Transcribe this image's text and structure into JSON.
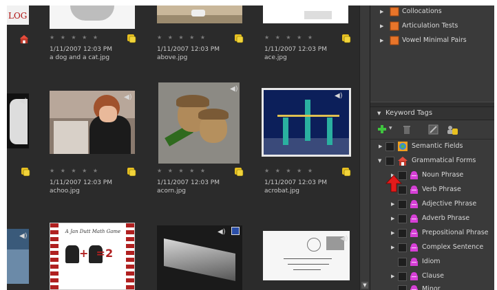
{
  "grid": {
    "row1": [
      {
        "date": "1/11/2007 12:03 PM",
        "name": "a dog and a cat.jpg",
        "stars": "★ ★ ★ ★ ★"
      },
      {
        "date": "1/11/2007 12:03 PM",
        "name": "above.jpg",
        "stars": "★ ★ ★ ★ ★"
      },
      {
        "date": "1/11/2007 12:03 PM",
        "name": "ace.jpg",
        "stars": "★ ★ ★ ★ ★"
      }
    ],
    "row2": [
      {
        "date": "1/11/2007 12:03 PM",
        "name": "achoo.jpg",
        "stars": "★ ★ ★ ★ ★"
      },
      {
        "date": "1/11/2007 12:03 PM",
        "name": "acorn.jpg",
        "stars": "★ ★ ★ ★ ★"
      },
      {
        "date": "1/11/2007 12:03 PM",
        "name": "acrobat.jpg",
        "stars": "★ ★ ★ ★ ★"
      }
    ],
    "left_logo_text": "LOG",
    "game_card_title": "A Jan Dutt Math Game",
    "game_card_math": "+  =2"
  },
  "panel": {
    "top_items": [
      {
        "label": "Collocations"
      },
      {
        "label": "Articulation Tests"
      },
      {
        "label": "Vowel Minimal Pairs"
      }
    ],
    "keyword_header": "Keyword Tags",
    "tags": [
      {
        "label": "Semantic Fields"
      },
      {
        "label": "Grammatical Forms"
      },
      {
        "label": "Noun Phrase"
      },
      {
        "label": "Verb Phrase"
      },
      {
        "label": "Adjective Phrase"
      },
      {
        "label": "Adverb Phrase"
      },
      {
        "label": "Prepositional Phrase"
      },
      {
        "label": "Complex Sentence"
      },
      {
        "label": "Idiom"
      },
      {
        "label": "Clause"
      },
      {
        "label": "Minor"
      }
    ]
  },
  "colors": {
    "panel_bg": "#3a3a3a",
    "grid_bg": "#2b2b2b",
    "accent_orange": "#e8752a",
    "tag_pink": "#d63fd6",
    "pointer_red": "#e21b1b"
  }
}
